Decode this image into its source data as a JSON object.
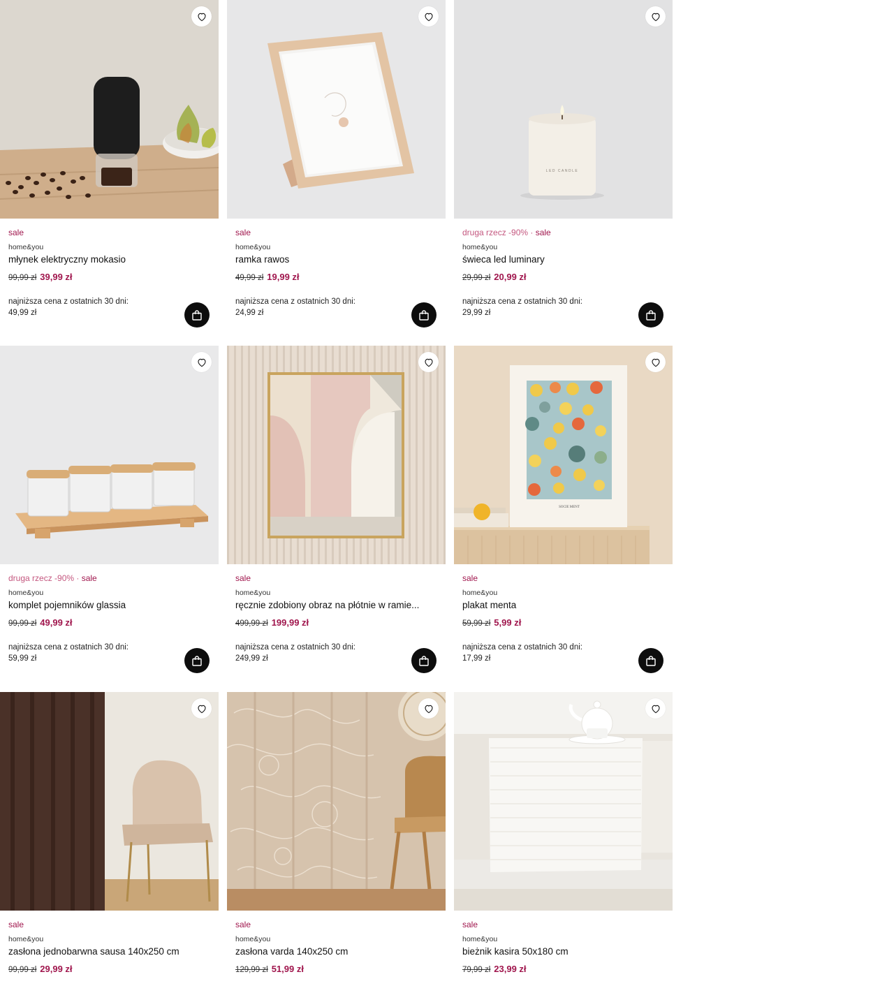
{
  "products": [
    {
      "promo": "",
      "sale": "sale",
      "brand": "home&you",
      "name": "młynek elektryczny mokasio",
      "old_price": "99,99 zł",
      "new_price": "39,99 zł",
      "lowest_label": "najniższa cena z ostatnich 30 dni:",
      "lowest_price": "49,99 zł"
    },
    {
      "promo": "",
      "sale": "sale",
      "brand": "home&you",
      "name": "ramka rawos",
      "old_price": "49,99 zł",
      "new_price": "19,99 zł",
      "lowest_label": "najniższa cena z ostatnich 30 dni:",
      "lowest_price": "24,99 zł"
    },
    {
      "promo": "druga rzecz -90%",
      "sale": "sale",
      "brand": "home&you",
      "name": "świeca led luminary",
      "old_price": "29,99 zł",
      "new_price": "20,99 zł",
      "lowest_label": "najniższa cena z ostatnich 30 dni:",
      "lowest_price": "29,99 zł"
    },
    {
      "promo": "druga rzecz -90%",
      "sale": "sale",
      "brand": "home&you",
      "name": "komplet pojemników glassia",
      "old_price": "99,99 zł",
      "new_price": "49,99 zł",
      "lowest_label": "najniższa cena z ostatnich 30 dni:",
      "lowest_price": "59,99 zł"
    },
    {
      "promo": "",
      "sale": "sale",
      "brand": "home&you",
      "name": "ręcznie zdobiony obraz na płótnie w ramie...",
      "old_price": "499,99 zł",
      "new_price": "199,99 zł",
      "lowest_label": "najniższa cena z ostatnich 30 dni:",
      "lowest_price": "249,99 zł"
    },
    {
      "promo": "",
      "sale": "sale",
      "brand": "home&you",
      "name": "plakat menta",
      "old_price": "59,99 zł",
      "new_price": "5,99 zł",
      "lowest_label": "najniższa cena z ostatnich 30 dni:",
      "lowest_price": "17,99 zł"
    },
    {
      "promo": "",
      "sale": "sale",
      "brand": "home&you",
      "name": "zasłona jednobarwna sausa 140x250 cm",
      "old_price": "99,99 zł",
      "new_price": "29,99 zł"
    },
    {
      "promo": "",
      "sale": "sale",
      "brand": "home&you",
      "name": "zasłona varda 140x250 cm",
      "old_price": "129,99 zł",
      "new_price": "51,99 zł"
    },
    {
      "promo": "",
      "sale": "sale",
      "brand": "home&you",
      "name": "bieżnik kasira 50x180 cm",
      "old_price": "79,99 zł",
      "new_price": "23,99 zł"
    }
  ],
  "candle_label": "LED CANDLE",
  "poster_label": "SOCIE MENT",
  "colors": {
    "sale": "#a0164d",
    "promo": "#c4577f",
    "cart_button": "#0d0d0d"
  },
  "icons": {
    "wishlist": "heart-icon",
    "cart": "shopping-bag-icon"
  }
}
